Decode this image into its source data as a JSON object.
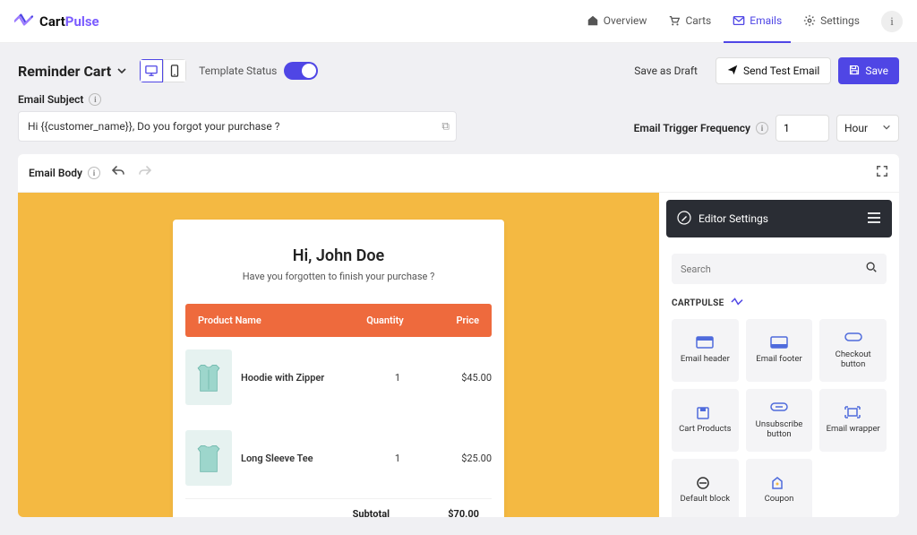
{
  "brand": {
    "name_part1": "Cart",
    "name_part2": "Pulse"
  },
  "nav": {
    "overview": "Overview",
    "carts": "Carts",
    "emails": "Emails",
    "settings": "Settings"
  },
  "toolbar": {
    "title": "Reminder Cart",
    "template_status_label": "Template Status",
    "save_draft": "Save as Draft",
    "send_test": "Send Test Email",
    "save": "Save"
  },
  "subject": {
    "label": "Email Subject",
    "value": "Hi {{customer_name}}, Do you forgot your purchase ?"
  },
  "trigger": {
    "label": "Email Trigger Frequency",
    "value": "1",
    "unit": "Hour"
  },
  "body": {
    "label": "Email Body"
  },
  "email": {
    "greeting": "Hi, John Doe",
    "subtext": "Have you forgotten to finish your purchase ?",
    "cols": {
      "name": "Product Name",
      "qty": "Quantity",
      "price": "Price"
    },
    "rows": [
      {
        "name": "Hoodie with Zipper",
        "qty": "1",
        "price": "$45.00"
      },
      {
        "name": "Long Sleeve Tee",
        "qty": "1",
        "price": "$25.00"
      }
    ],
    "subtotal_label": "Subtotal",
    "subtotal_value": "$70.00"
  },
  "sidebar": {
    "title": "Editor Settings",
    "search_placeholder": "Search",
    "section": "CARTPULSE",
    "blocks": {
      "email_header": "Email header",
      "email_footer": "Email footer",
      "checkout_button": "Checkout button",
      "cart_products": "Cart Products",
      "unsubscribe": "Unsubscribe button",
      "email_wrapper": "Email wrapper",
      "default_block": "Default block",
      "coupon": "Coupon"
    }
  }
}
